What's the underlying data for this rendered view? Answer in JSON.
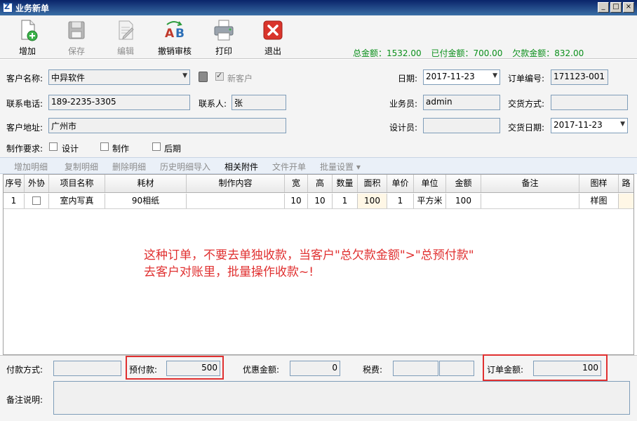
{
  "window": {
    "title": "业务新单",
    "minimize": "_",
    "maximize": "□",
    "close": "×"
  },
  "toolbar": {
    "add": "增加",
    "save": "保存",
    "edit": "编辑",
    "revoke": "撤销审核",
    "print": "打印",
    "exit": "退出"
  },
  "totals": {
    "total": "总金额：1532.00",
    "paid": "已付金额：700.00",
    "owed": "欠款金额：832.00"
  },
  "form": {
    "customer_name_label": "客户名称:",
    "customer_name": "中异软件",
    "new_customer_label": "新客户",
    "date_label": "日期:",
    "date": "2017-11-23",
    "order_no_label": "订单编号:",
    "order_no": "171123-001",
    "phone_label": "联系电话:",
    "phone": "189-2235-3305",
    "contact_label": "联系人:",
    "contact": "张",
    "salesman_label": "业务员:",
    "salesman": "admin",
    "delivery_method_label": "交货方式:",
    "delivery_method": "",
    "address_label": "客户地址:",
    "address": "广州市",
    "designer_label": "设计员:",
    "designer": "",
    "delivery_date_label": "交货日期:",
    "delivery_date": "2017-11-23",
    "requirements_label": "制作要求:",
    "req_design": "设计",
    "req_make": "制作",
    "req_post": "后期"
  },
  "subtoolbar": {
    "add_detail": "增加明细",
    "copy_detail": "复制明细",
    "delete_detail": "删除明细",
    "import_history": "历史明细导入",
    "attachments": "相关附件",
    "file_open": "文件开单",
    "batch_settings": "批量设置 ▾"
  },
  "grid": {
    "headers": [
      "序号",
      "外协",
      "项目名称",
      "耗材",
      "制作内容",
      "宽",
      "高",
      "数量",
      "面积",
      "单价",
      "单位",
      "金额",
      "备注",
      "图样",
      "路"
    ],
    "rows": [
      {
        "no": "1",
        "outsource": "",
        "item": "室内写真",
        "material": "90相纸",
        "content": "",
        "width": "10",
        "height": "10",
        "qty": "1",
        "area": "100",
        "price": "1",
        "unit": "平方米",
        "amount": "100",
        "note": "",
        "sample": "样图",
        "route": ""
      }
    ]
  },
  "annotation": {
    "line1": "这种订单，不要去单独收款，当客户\"总欠款金额\">\"总预付款\"",
    "line2": "去客户对账里，批量操作收款~!"
  },
  "bottom": {
    "payment_method_label": "付款方式:",
    "payment_method": "",
    "prepay_label": "预付款:",
    "prepay": "500",
    "discount_label": "优惠金额:",
    "discount": "0",
    "tax_label": "税费:",
    "tax1": "",
    "tax2": "",
    "order_amount_label": "订单金额:",
    "order_amount": "100",
    "remarks_label": "备注说明:",
    "remarks": ""
  },
  "colors": {
    "totals_green": "#0a8f1a",
    "annotation_red": "#e03030",
    "titlebar": "#0a246a"
  },
  "icons": {
    "add": "document-add-icon",
    "save": "floppy-disk-icon",
    "edit": "edit-document-icon",
    "revoke": "ab-revoke-icon",
    "print": "printer-icon",
    "exit": "close-red-icon"
  }
}
